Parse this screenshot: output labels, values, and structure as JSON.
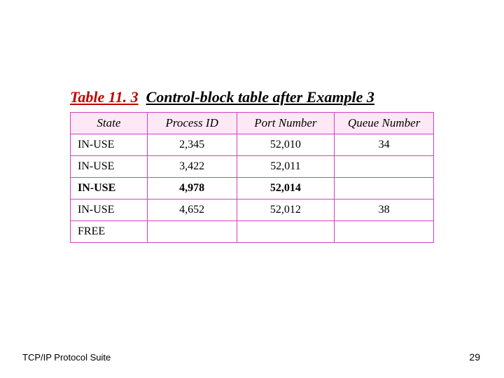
{
  "caption": {
    "table_number": "Table 11. 3",
    "title_rest": "Control-block table after Example 3"
  },
  "table": {
    "headers": [
      "State",
      "Process ID",
      "Port Number",
      "Queue Number"
    ],
    "rows": [
      {
        "state": "IN-USE",
        "pid": "2,345",
        "port": "52,010",
        "qn": "34",
        "bold": false
      },
      {
        "state": "IN-USE",
        "pid": "3,422",
        "port": "52,011",
        "qn": "",
        "bold": false
      },
      {
        "state": "IN-USE",
        "pid": "4,978",
        "port": "52,014",
        "qn": "",
        "bold": true
      },
      {
        "state": "IN-USE",
        "pid": "4,652",
        "port": "52,012",
        "qn": "38",
        "bold": false
      },
      {
        "state": "FREE",
        "pid": "",
        "port": "",
        "qn": "",
        "bold": false
      }
    ]
  },
  "footer": {
    "left": "TCP/IP Protocol Suite",
    "right": "29"
  },
  "chart_data": {
    "type": "table",
    "title": "Table 11.3 Control-block table after Example 3",
    "columns": [
      "State",
      "Process ID",
      "Port Number",
      "Queue Number"
    ],
    "rows": [
      [
        "IN-USE",
        2345,
        52010,
        34
      ],
      [
        "IN-USE",
        3422,
        52011,
        null
      ],
      [
        "IN-USE",
        4978,
        52014,
        null
      ],
      [
        "IN-USE",
        4652,
        52012,
        38
      ],
      [
        "FREE",
        null,
        null,
        null
      ]
    ]
  }
}
